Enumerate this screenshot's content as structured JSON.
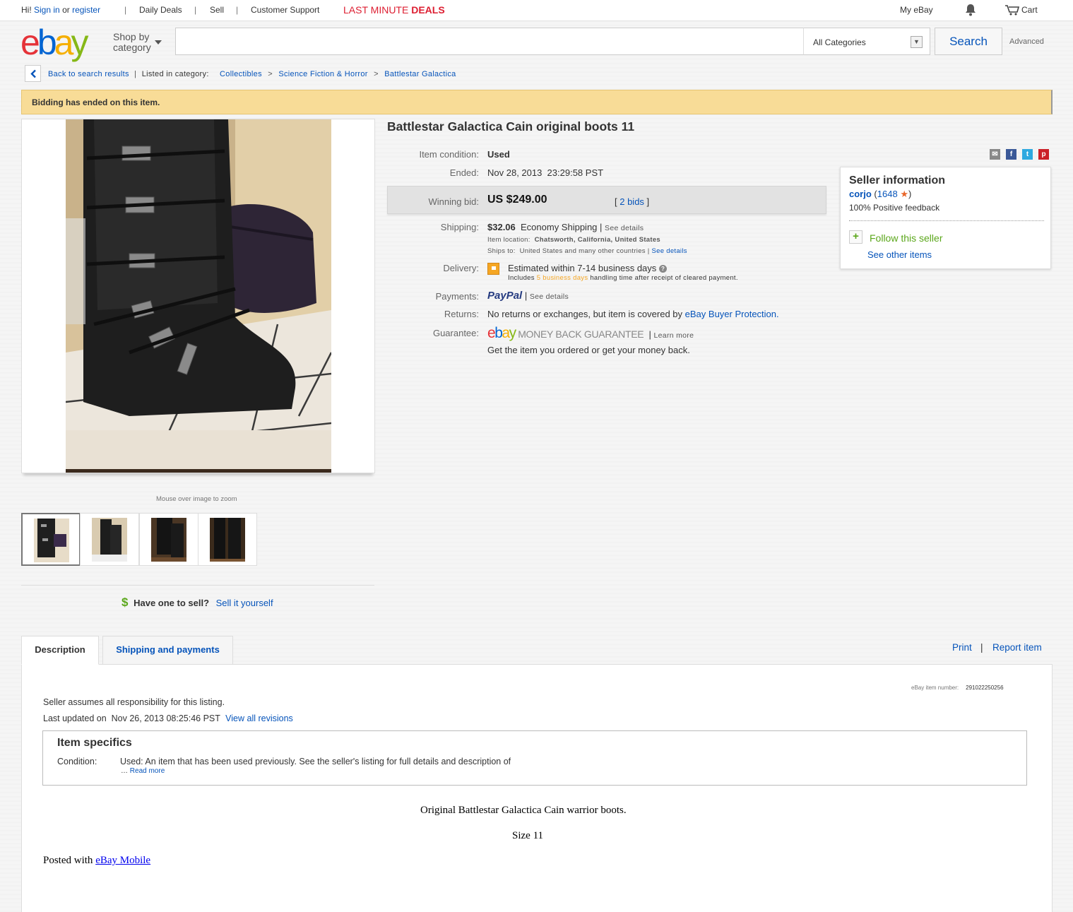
{
  "topbar": {
    "greeting": "Hi!",
    "sign_in": "Sign in",
    "or": "or",
    "register": "register",
    "daily_deals": "Daily Deals",
    "sell": "Sell",
    "support": "Customer Support",
    "deals_prefix": "LAST MINUTE",
    "deals_bold": "DEALS",
    "my_ebay": "My eBay",
    "cart": "Cart"
  },
  "header": {
    "logo_letters": [
      "e",
      "b",
      "a",
      "y"
    ],
    "shop_by_line1": "Shop by",
    "shop_by_line2": "category",
    "search_placeholder": "",
    "category_select": "All Categories",
    "search_button": "Search",
    "advanced": "Advanced"
  },
  "breadcrumb": {
    "back": "Back to search results",
    "listed_in": "Listed in category:",
    "items": [
      "Collectibles",
      "Science Fiction & Horror",
      "Battlestar Galactica"
    ]
  },
  "banner": "Bidding has ended on this item.",
  "gallery": {
    "zoom_hint": "Mouse over image to zoom",
    "have_one": "Have one to sell?",
    "sell_it": "Sell it yourself"
  },
  "item": {
    "title": "Battlestar Galactica Cain original boots 11",
    "condition_label": "Item condition:",
    "condition": "Used",
    "ended_label": "Ended:",
    "ended": "Nov 28, 2013  23:29:58 PST",
    "winning_label": "Winning bid:",
    "winning_bid": "US $249.00",
    "bids": "2 bids",
    "shipping_label": "Shipping:",
    "shipping_cost": "$32.06",
    "shipping_method": "Economy Shipping",
    "see_details": "See details",
    "location_label": "Item location:",
    "location": "Chatsworth, California, United States",
    "ships_to_label": "Ships to:",
    "ships_to": "United States and many other countries",
    "delivery_label": "Delivery:",
    "delivery": "Estimated within 7-14 business days",
    "handling_pre": "Includes",
    "handling_days": "5 business days",
    "handling_post": "handling time after receipt of cleared payment.",
    "payments_label": "Payments:",
    "paypal": "PayPal",
    "returns_label": "Returns:",
    "returns": "No returns or exchanges, but item is covered by",
    "buyer_protection": "eBay Buyer Protection.",
    "guarantee_label": "Guarantee:",
    "guarantee_text": "MONEY BACK GUARANTEE",
    "learn_more": "Learn more",
    "guarantee_line": "Get the item you ordered or get your money back."
  },
  "seller": {
    "header": "Seller information",
    "name": "corjo",
    "score": "1648",
    "feedback": "100% Positive feedback",
    "follow": "Follow this seller",
    "other_items": "See other items"
  },
  "tabs": {
    "description": "Description",
    "shipping": "Shipping and payments",
    "print": "Print",
    "report": "Report item"
  },
  "description": {
    "item_number_label": "eBay item number:",
    "item_number": "291022250256",
    "responsibility": "Seller assumes all responsibility for this listing.",
    "updated_label": "Last updated on",
    "updated": "Nov 26, 2013 08:25:46 PST",
    "revisions": "View all revisions",
    "specifics_header": "Item specifics",
    "condition_key": "Condition:",
    "condition_value": "Used: An item that has been used previously. See the seller's listing for full details and description of",
    "read_more": "Read more",
    "line1": "Original Battlestar Galactica Cain warrior boots.",
    "line2": "Size 11",
    "posted_with": "Posted with",
    "ebay_mobile": "eBay Mobile"
  },
  "colors": {
    "ebay_red": "#e53238",
    "ebay_blue": "#0064d2",
    "ebay_yellow": "#f5af02",
    "ebay_green": "#86b817",
    "link": "#0654ba",
    "banner": "#f8dc97"
  }
}
